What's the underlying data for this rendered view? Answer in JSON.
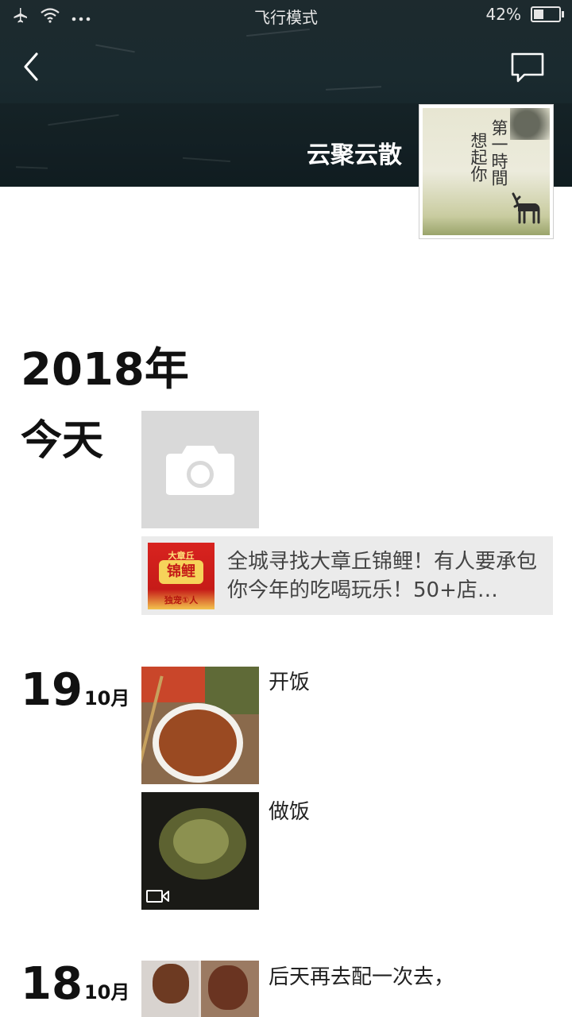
{
  "status_bar": {
    "center": "飞行模式",
    "battery": "42%",
    "battery_level": 0.42
  },
  "header": {
    "username": "云聚云散",
    "avatar_text": [
      "第一時間",
      "想起你"
    ]
  },
  "timeline": {
    "year": "2018年",
    "today_label": "今天",
    "ad": {
      "thumb_top": "大章丘",
      "thumb_main": "锦鲤",
      "thumb_bottom": "独宠①人",
      "text": "全城寻找大章丘锦鲤！有人要承包你今年的吃喝玩乐！50+店…"
    },
    "days": [
      {
        "day": "19",
        "month": "10月",
        "posts": [
          {
            "text": "开饭",
            "type": "photo"
          },
          {
            "text": "做饭",
            "type": "video"
          }
        ]
      },
      {
        "day": "18",
        "month": "10月",
        "posts": [
          {
            "text": "后天再去配一次去，",
            "type": "photo"
          }
        ]
      }
    ]
  },
  "icons": {
    "airplane": "airplane-icon",
    "wifi": "wifi-icon",
    "more": "more-icon",
    "back": "back-arrow-icon",
    "message": "message-icon",
    "camera": "camera-icon",
    "video": "video-icon"
  },
  "colors": {
    "header_bg": "#1a2a2f",
    "tile_bg": "#d9d9d9",
    "ad_bg": "#ebebeb",
    "ad_thumb_red": "#d8231f"
  }
}
